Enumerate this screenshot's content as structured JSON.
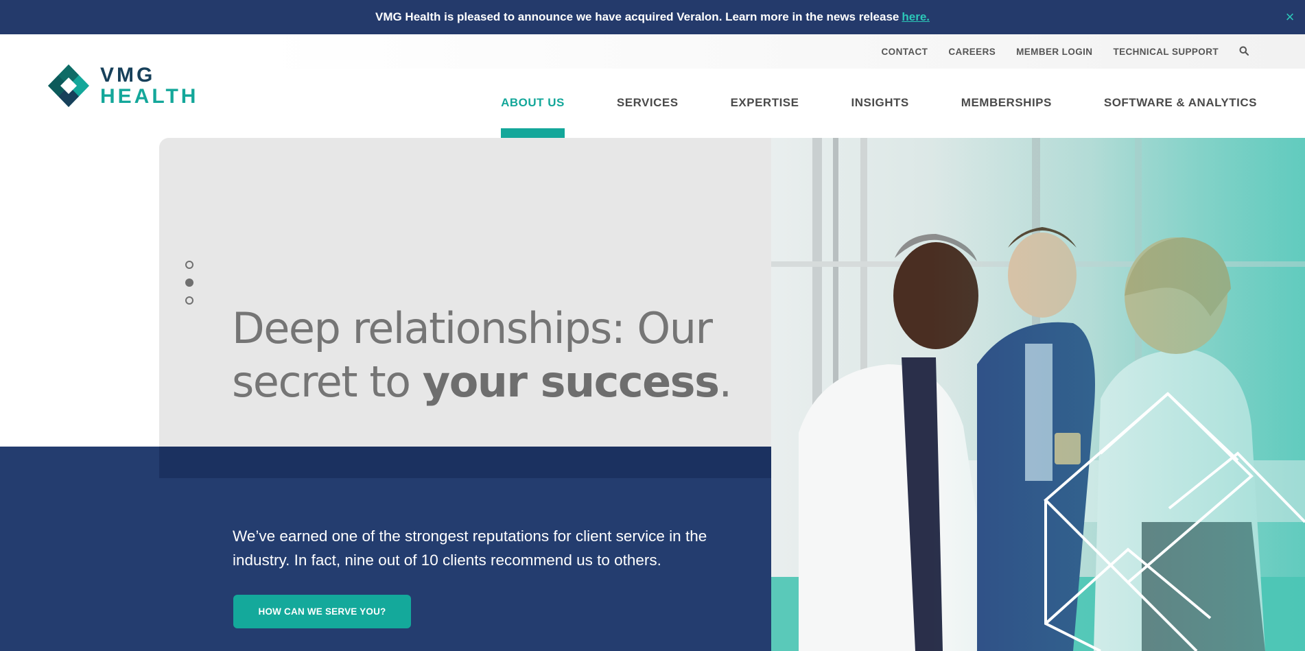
{
  "announcement": {
    "text": "VMG Health is pleased to announce we have acquired Veralon. Learn more in the news release",
    "link_label": "here.",
    "close_label": "×"
  },
  "utility_nav": {
    "items": [
      "CONTACT",
      "CAREERS",
      "MEMBER LOGIN",
      "TECHNICAL SUPPORT"
    ],
    "search_icon": "search-icon"
  },
  "logo": {
    "line1": "VMG",
    "line2": "HEALTH"
  },
  "main_nav": {
    "items": [
      {
        "label": "ABOUT US",
        "active": true
      },
      {
        "label": "SERVICES",
        "active": false
      },
      {
        "label": "EXPERTISE",
        "active": false
      },
      {
        "label": "INSIGHTS",
        "active": false
      },
      {
        "label": "MEMBERSHIPS",
        "active": false
      },
      {
        "label": "SOFTWARE & ANALYTICS",
        "active": false
      }
    ]
  },
  "hero": {
    "headline_part1": "Deep relationships: Our secret to ",
    "headline_bold": "your success",
    "headline_end": ".",
    "body": "We’ve earned one of the strongest reputations for client service in the industry. In fact, nine out of 10 clients recommend us to others.",
    "cta_label": "HOW CAN WE SERVE YOU?",
    "slides": {
      "count": 3,
      "active_index": 1
    }
  },
  "colors": {
    "navy": "#243d6f",
    "navy_dark": "#1b3160",
    "teal": "#14a79a",
    "gray_panel": "#e7e7e7",
    "headline_gray": "#757575"
  }
}
